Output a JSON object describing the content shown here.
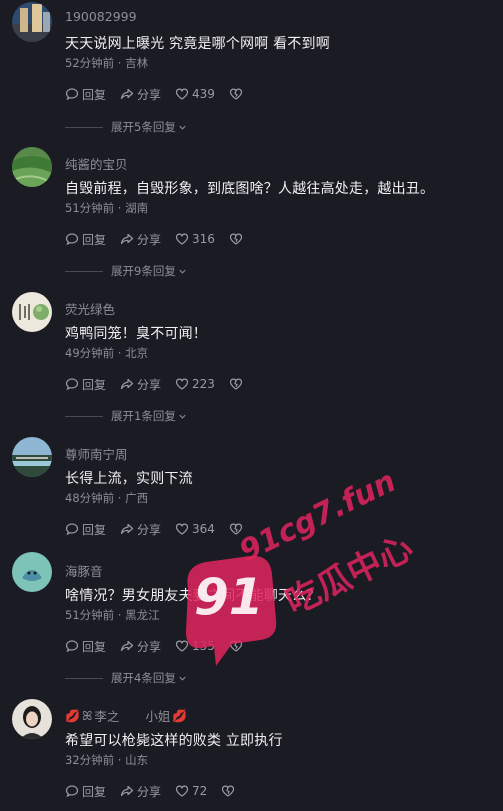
{
  "comments": [
    {
      "username": "190082999",
      "text": "天天说网上曝光 究竟是哪个网啊 看不到啊",
      "meta": "52分钟前 · 吉林",
      "reply_label": "回复",
      "share_label": "分享",
      "likes": "439",
      "expand_label": "展开5条回复"
    },
    {
      "username": "纯酱的宝贝",
      "text": "自毁前程，自毁形象，到底图啥？人越往高处走，越出丑。",
      "meta": "51分钟前 · 湖南",
      "reply_label": "回复",
      "share_label": "分享",
      "likes": "316",
      "expand_label": "展开9条回复"
    },
    {
      "username": "荧光绿色",
      "text": "鸡鸭同笼！臭不可闻！",
      "meta": "49分钟前 · 北京",
      "reply_label": "回复",
      "share_label": "分享",
      "likes": "223",
      "expand_label": "展开1条回复"
    },
    {
      "username": "尊师南宁周",
      "text": "长得上流，实则下流",
      "meta": "48分钟前 · 广西",
      "reply_label": "回复",
      "share_label": "分享",
      "likes": "364"
    },
    {
      "username": "海豚音",
      "text": "啥情况？男女朋友夫妻之间不能聊天么？",
      "meta": "51分钟前 · 黑龙江",
      "reply_label": "回复",
      "share_label": "分享",
      "likes": "135",
      "expand_label": "展开4条回复"
    },
    {
      "username": "李之",
      "username_suffix": "小姐",
      "text": "希望可以枪毙这样的败类 立即执行",
      "meta": "32分钟前 · 山东",
      "reply_label": "回复",
      "share_label": "分享",
      "likes": "72"
    }
  ],
  "watermark": {
    "domain": "91cg7.fun",
    "brand": "吃瓜中心",
    "number": "91"
  },
  "colors": {
    "background": "#1b1b23",
    "text_primary": "#f0f0f2",
    "text_secondary": "#8d8d95",
    "watermark": "#e0245e"
  }
}
